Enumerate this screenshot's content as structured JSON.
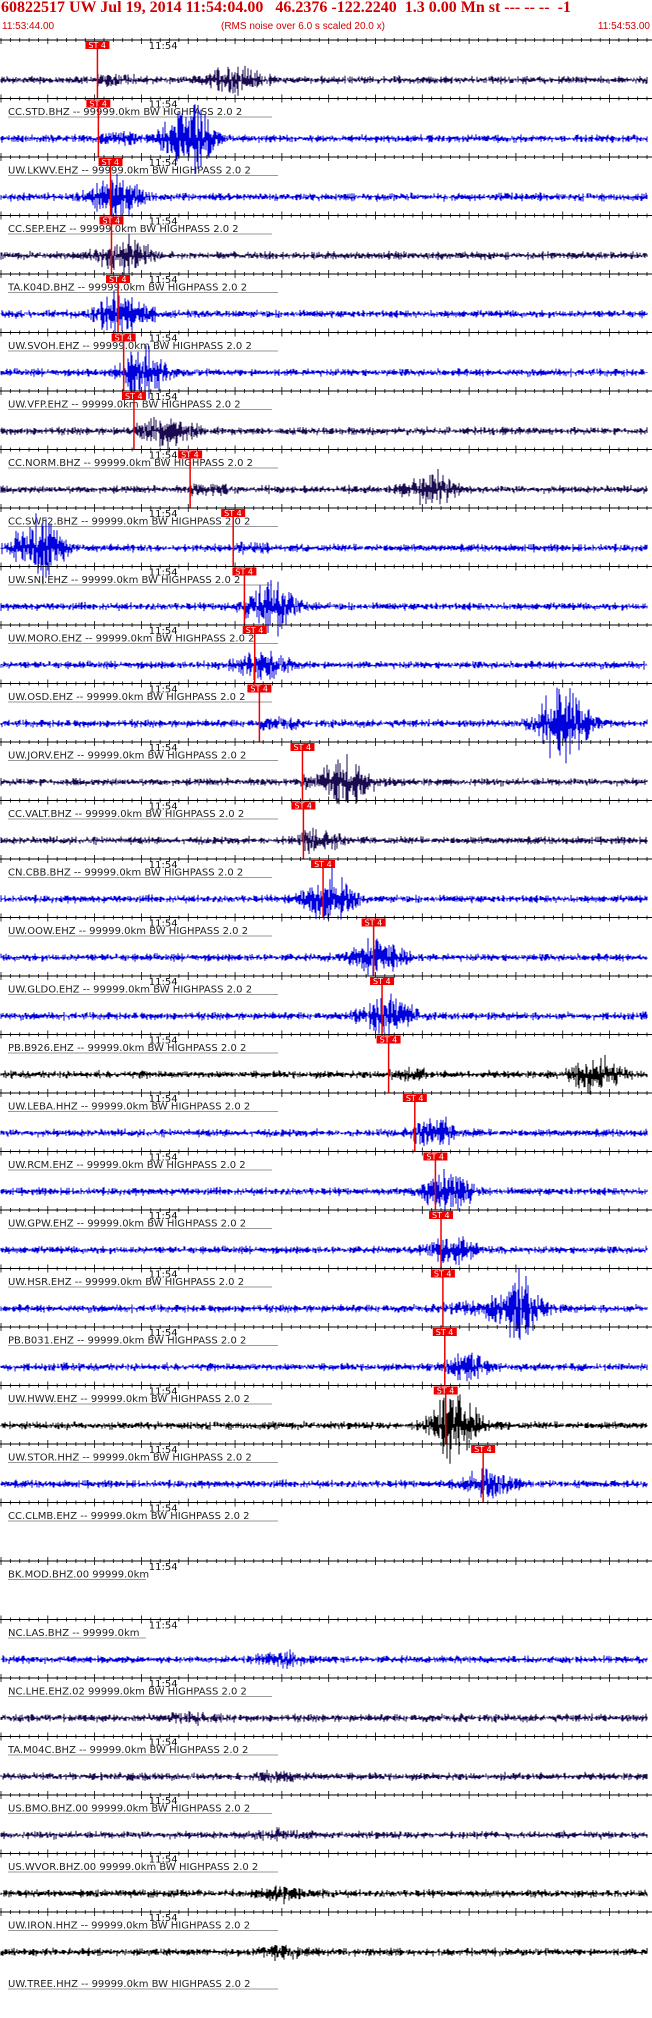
{
  "header": {
    "title": "60822517 UW Jul 19, 2014 11:54:04.00   46.2376 -122.2240  1.3 0.00 Mn st --- -- --  -1",
    "start_time": "11:53:44.00",
    "scaling_note": "(RMS noise over 6.0 s scaled 20.0 x)",
    "end_time": "11:54:53.00"
  },
  "colors": {
    "header_text": "#d00000",
    "trace_blue": "#0000dd",
    "trace_navy": "#1a0a50",
    "trace_black": "#000000",
    "pick": "#ee0000",
    "axis": "#000000"
  },
  "chart_data": {
    "type": "seismogram_stack",
    "time_range": [
      "11:53:44.00",
      "11:54:53.00"
    ],
    "time_tick_label": "11:54",
    "filter": "HIGHPASS 2.0 2",
    "pick_label": "ST 4",
    "traces": [
      {
        "label": "CC.STD.BHZ -- 99999.0km BW  HIGHPASS  2.0  2",
        "color": "navy",
        "pick_s": 10.3,
        "burst_s": 25,
        "burst_amp": 0.4
      },
      {
        "label": "UW.LKWV.EHZ -- 99999.0km BW  HIGHPASS  2.0  2",
        "color": "blue",
        "pick_s": 10.4,
        "burst_s": 20,
        "burst_amp": 0.9
      },
      {
        "label": "CC.SEP.EHZ -- 99999.0km BW  HIGHPASS  2.0  2",
        "color": "blue",
        "pick_s": 11.7,
        "burst_s": 12,
        "burst_amp": 0.5
      },
      {
        "label": "TA.K04D.BHZ -- 99999.0km BW  HIGHPASS  2.0  2",
        "color": "navy",
        "pick_s": 11.8,
        "burst_s": 13,
        "burst_amp": 0.45
      },
      {
        "label": "UW.SVOH.EHZ -- 99999.0km BW  HIGHPASS  2.0  2",
        "color": "blue",
        "pick_s": 12.5,
        "burst_s": 12.5,
        "burst_amp": 0.5
      },
      {
        "label": "UW.VFP.EHZ -- 99999.0km BW  HIGHPASS  2.0  2",
        "color": "blue",
        "pick_s": 13.1,
        "burst_s": 15,
        "burst_amp": 0.55
      },
      {
        "label": "CC.NORM.BHZ -- 99999.0km BW  HIGHPASS  2.0  2",
        "color": "navy",
        "pick_s": 14.2,
        "burst_s": 18,
        "burst_amp": 0.35
      },
      {
        "label": "CC.SWF2.BHZ -- 99999.0km BW  HIGHPASS  2.0  2",
        "color": "navy",
        "pick_s": 20.2,
        "burst_s": 46,
        "burst_amp": 0.45
      },
      {
        "label": "UW.SNI.EHZ -- 99999.0km BW  HIGHPASS  2.0  2",
        "color": "blue",
        "pick_s": 24.8,
        "burst_s": 4,
        "burst_amp": 0.8
      },
      {
        "label": "UW.MORO.EHZ -- 99999.0km BW  HIGHPASS  2.0  2",
        "color": "blue",
        "pick_s": 26.0,
        "burst_s": 29,
        "burst_amp": 0.55
      },
      {
        "label": "UW.OSD.EHZ -- 99999.0km BW  HIGHPASS  2.0  2",
        "color": "blue",
        "pick_s": 27.1,
        "burst_s": 27.5,
        "burst_amp": 0.3
      },
      {
        "label": "UW.JORV.EHZ -- 99999.0km BW  HIGHPASS  2.0  2",
        "color": "blue",
        "pick_s": 27.6,
        "burst_s": 60,
        "burst_amp": 1.0
      },
      {
        "label": "CC.VALT.BHZ -- 99999.0km BW  HIGHPASS  2.0  2",
        "color": "navy",
        "pick_s": 32.2,
        "burst_s": 37,
        "burst_amp": 0.6
      },
      {
        "label": "CN.CBB.BHZ -- 99999.0km BW  HIGHPASS  2.0  2",
        "color": "navy",
        "pick_s": 32.3,
        "burst_s": 34,
        "burst_amp": 0.2
      },
      {
        "label": "UW.OOW.EHZ -- 99999.0km BW  HIGHPASS  2.0  2",
        "color": "blue",
        "pick_s": 34.4,
        "burst_s": 34.8,
        "burst_amp": 0.6
      },
      {
        "label": "UW.GLDO.EHZ -- 99999.0km BW  HIGHPASS  2.0  2",
        "color": "blue",
        "pick_s": 39.8,
        "burst_s": 40,
        "burst_amp": 0.45
      },
      {
        "label": "PB.B926.EHZ -- 99999.0km BW  HIGHPASS  2.0  2",
        "color": "blue",
        "pick_s": 40.7,
        "burst_s": 41,
        "burst_amp": 0.45
      },
      {
        "label": "UW.LEBA.HHZ -- 99999.0km BW  HIGHPASS  2.0  2",
        "color": "black",
        "pick_s": 41.4,
        "burst_s": 63.5,
        "burst_amp": 0.45
      },
      {
        "label": "UW.RCM.EHZ -- 99999.0km BW  HIGHPASS  2.0  2",
        "color": "blue",
        "pick_s": 44.2,
        "burst_s": 46,
        "burst_amp": 0.3
      },
      {
        "label": "UW.GPW.EHZ -- 99999.0km BW  HIGHPASS  2.0  2",
        "color": "blue",
        "pick_s": 46.4,
        "burst_s": 47.5,
        "burst_amp": 0.45
      },
      {
        "label": "UW.HSR.EHZ -- 99999.0km BW  HIGHPASS  2.0  2",
        "color": "blue",
        "pick_s": 47.0,
        "burst_s": 48,
        "burst_amp": 0.3
      },
      {
        "label": "PB.B031.EHZ -- 99999.0km BW  HIGHPASS  2.0  2",
        "color": "blue",
        "pick_s": 47.2,
        "burst_s": 55,
        "burst_amp": 0.9
      },
      {
        "label": "UW.HWW.EHZ -- 99999.0km BW  HIGHPASS  2.0  2",
        "color": "blue",
        "pick_s": 47.4,
        "burst_s": 50,
        "burst_amp": 0.25
      },
      {
        "label": "UW.STOR.HHZ -- 99999.0km BW  HIGHPASS  2.0  2",
        "color": "black",
        "pick_s": 47.5,
        "burst_s": 48.5,
        "burst_amp": 0.85
      },
      {
        "label": "CC.CLMB.EHZ -- 99999.0km BW  HIGHPASS  2.0  2",
        "color": "blue",
        "pick_s": 51.5,
        "burst_s": 51.7,
        "burst_amp": 0.3
      },
      {
        "label": "BK.MOD.BHZ.00 99999.0km",
        "color": "none"
      },
      {
        "label": "NC.LAS.BHZ -- 99999.0km",
        "color": "none"
      },
      {
        "label": "NC.LHE.EHZ.02 99999.0km BW  HIGHPASS  2.0  2",
        "color": "blue",
        "burst_s": 30,
        "burst_amp": 0.15
      },
      {
        "label": "TA.M04C.BHZ -- 99999.0km BW  HIGHPASS  2.0  2",
        "color": "navy",
        "burst_s": 20,
        "burst_amp": 0.1
      },
      {
        "label": "US.BMO.BHZ.00 99999.0km BW  HIGHPASS  2.0  2",
        "color": "navy",
        "burst_s": 30,
        "burst_amp": 0.1
      },
      {
        "label": "US.WVOR.BHZ.00 99999.0km BW  HIGHPASS  2.0  2",
        "color": "navy",
        "burst_s": 30,
        "burst_amp": 0.1
      },
      {
        "label": "UW.IRON.HHZ -- 99999.0km BW  HIGHPASS  2.0  2",
        "color": "black",
        "burst_s": 30,
        "burst_amp": 0.15
      },
      {
        "label": "UW.TREE.HHZ -- 99999.0km BW  HIGHPASS  2.0  2",
        "color": "black",
        "burst_s": 30,
        "burst_amp": 0.15
      }
    ]
  }
}
